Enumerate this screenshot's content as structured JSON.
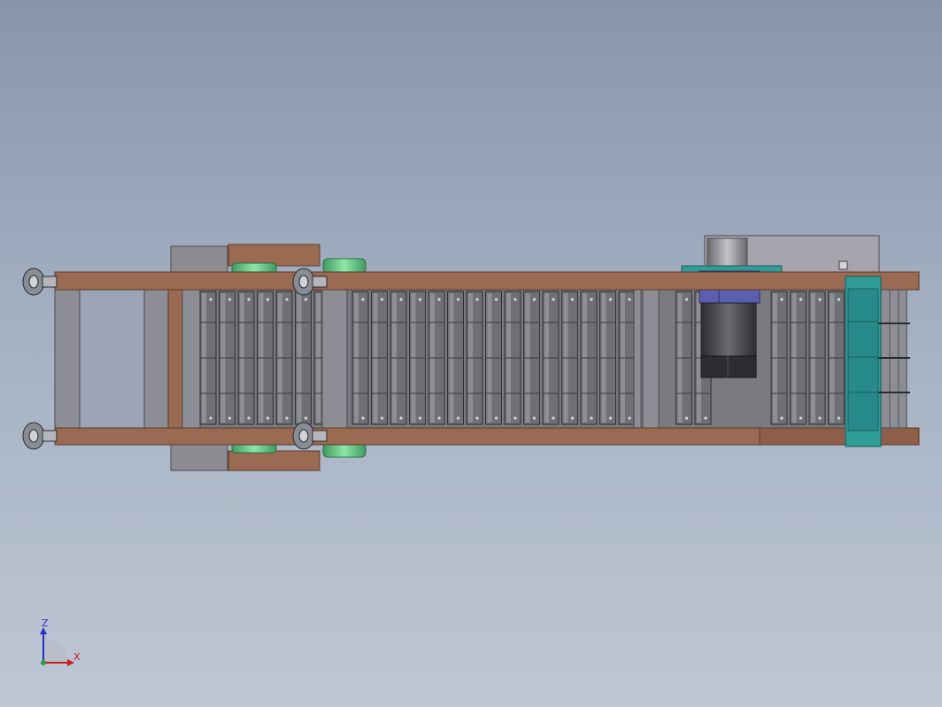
{
  "viewport": {
    "background_top": "#8796ab",
    "background_bottom": "#bec7d4"
  },
  "model": {
    "description_icon": "conveyor-3d-model",
    "colors": {
      "frame_wood": "#9a6a52",
      "frame_edge": "#5e3a2a",
      "slat": "#6f7074",
      "slat_light": "#8e8f93",
      "slat_dark": "#444549",
      "leg_gray": "#8a8a92",
      "pulley_green": "#6fcf8e",
      "motor_blue": "#5a5fb0",
      "motor_dark": "#3c3c40",
      "bracket_teal": "#2f9c98",
      "housing_gray": "#a8a4ae",
      "leveling_foot": "#8a8c94"
    }
  },
  "triad": {
    "z_label": "Z",
    "x_label": "X",
    "z_color": "#2830c8",
    "x_color": "#c81e1e"
  }
}
